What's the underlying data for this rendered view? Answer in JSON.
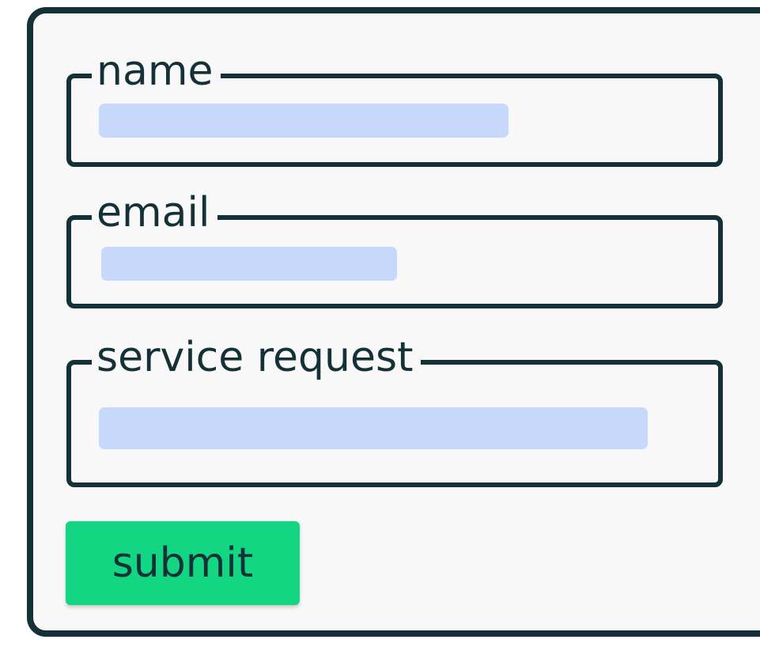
{
  "form": {
    "fields": [
      {
        "label": "name"
      },
      {
        "label": "email"
      },
      {
        "label": "service request"
      }
    ],
    "submit_label": "submit"
  },
  "colors": {
    "border": "#143137",
    "card_background": "#f8f8f9",
    "input_placeholder_fill": "#c7d9fb",
    "submit_button": "#12d682"
  }
}
